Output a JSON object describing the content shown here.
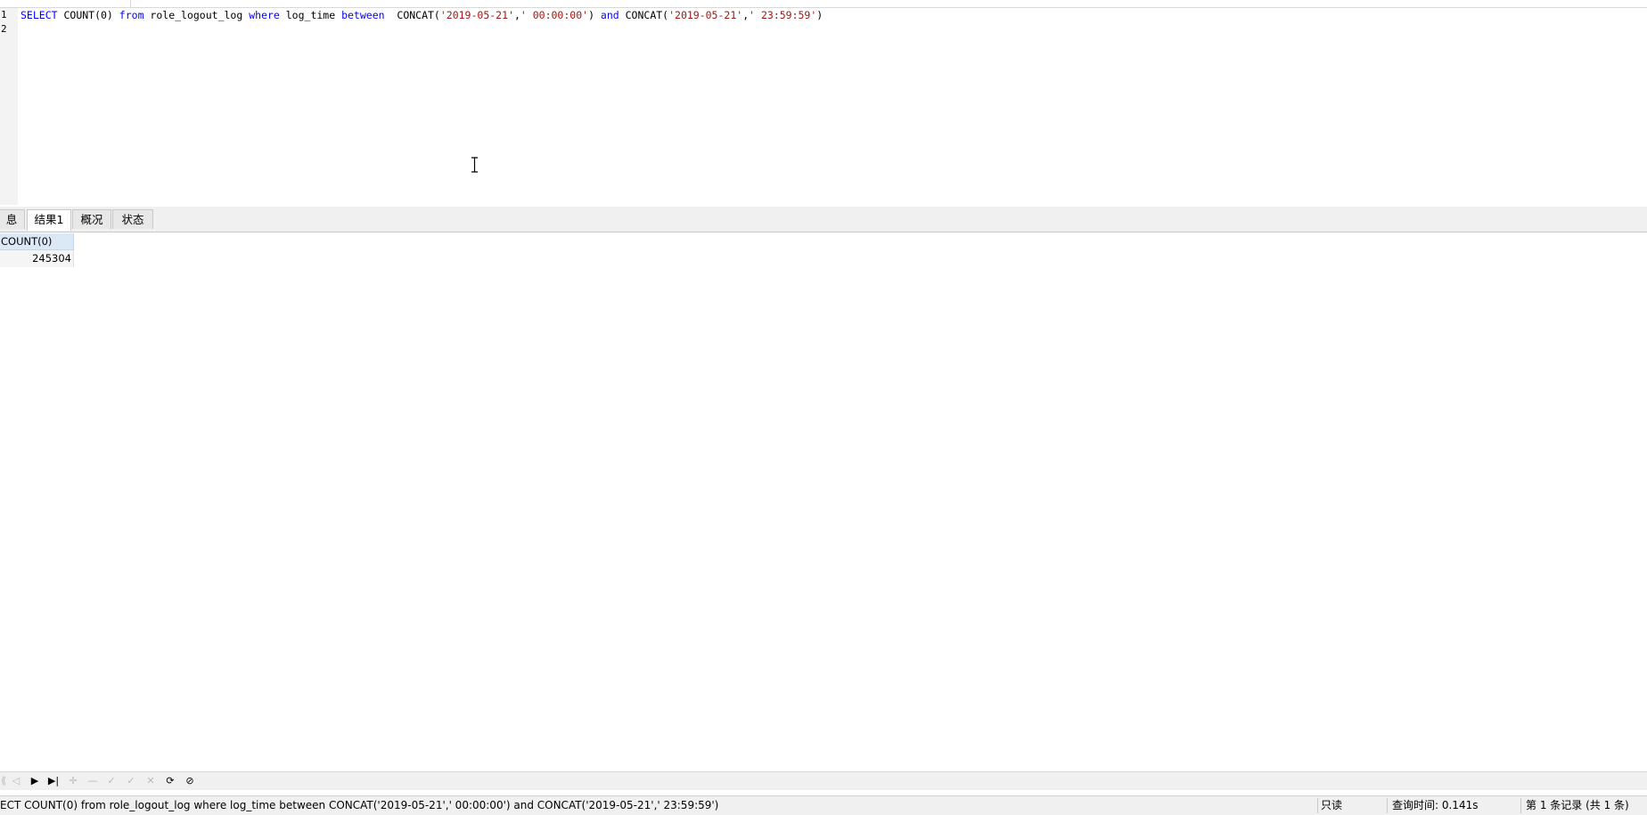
{
  "editor": {
    "line_numbers": [
      "1",
      "2"
    ],
    "query_tokens": [
      {
        "text": "SELECT",
        "kind": "kw"
      },
      {
        "text": " COUNT(0) ",
        "kind": "plain"
      },
      {
        "text": "from",
        "kind": "kw"
      },
      {
        "text": " role_logout_log ",
        "kind": "plain"
      },
      {
        "text": "where",
        "kind": "kw"
      },
      {
        "text": " log_time ",
        "kind": "plain"
      },
      {
        "text": "between",
        "kind": "kw"
      },
      {
        "text": "  CONCAT(",
        "kind": "plain"
      },
      {
        "text": "'2019-05-21'",
        "kind": "str"
      },
      {
        "text": ",",
        "kind": "plain"
      },
      {
        "text": "' 00:00:00'",
        "kind": "str"
      },
      {
        "text": ") ",
        "kind": "plain"
      },
      {
        "text": "and",
        "kind": "kw"
      },
      {
        "text": " CONCAT(",
        "kind": "plain"
      },
      {
        "text": "'2019-05-21'",
        "kind": "str"
      },
      {
        "text": ",",
        "kind": "plain"
      },
      {
        "text": "' 23:59:59'",
        "kind": "str"
      },
      {
        "text": ")",
        "kind": "plain"
      }
    ]
  },
  "tabs": {
    "info": "息",
    "result1": "结果1",
    "overview": "概况",
    "state": "状态"
  },
  "result_grid": {
    "columns": [
      "COUNT(0)"
    ],
    "rows": [
      [
        "245304"
      ]
    ]
  },
  "nav_toolbar": {
    "icons": [
      "first-record-icon",
      "prev-record-icon",
      "next-record-icon",
      "last-record-icon",
      "add-record-icon",
      "delete-record-icon",
      "apply-icon",
      "cancel-icon",
      "clear-icon",
      "refresh-icon",
      "stop-icon"
    ]
  },
  "status_bar": {
    "sql_text": "ECT COUNT(0) from role_logout_log where log_time between  CONCAT('2019-05-21',' 00:00:00') and CONCAT('2019-05-21',' 23:59:59')",
    "mode": "只读",
    "query_time": "查询时间: 0.141s",
    "record_info": "第 1 条记录 (共 1 条)"
  },
  "colors": {
    "keyword": "#0000ff",
    "string": "#a31515",
    "header_bg": "#dbe9f7"
  }
}
